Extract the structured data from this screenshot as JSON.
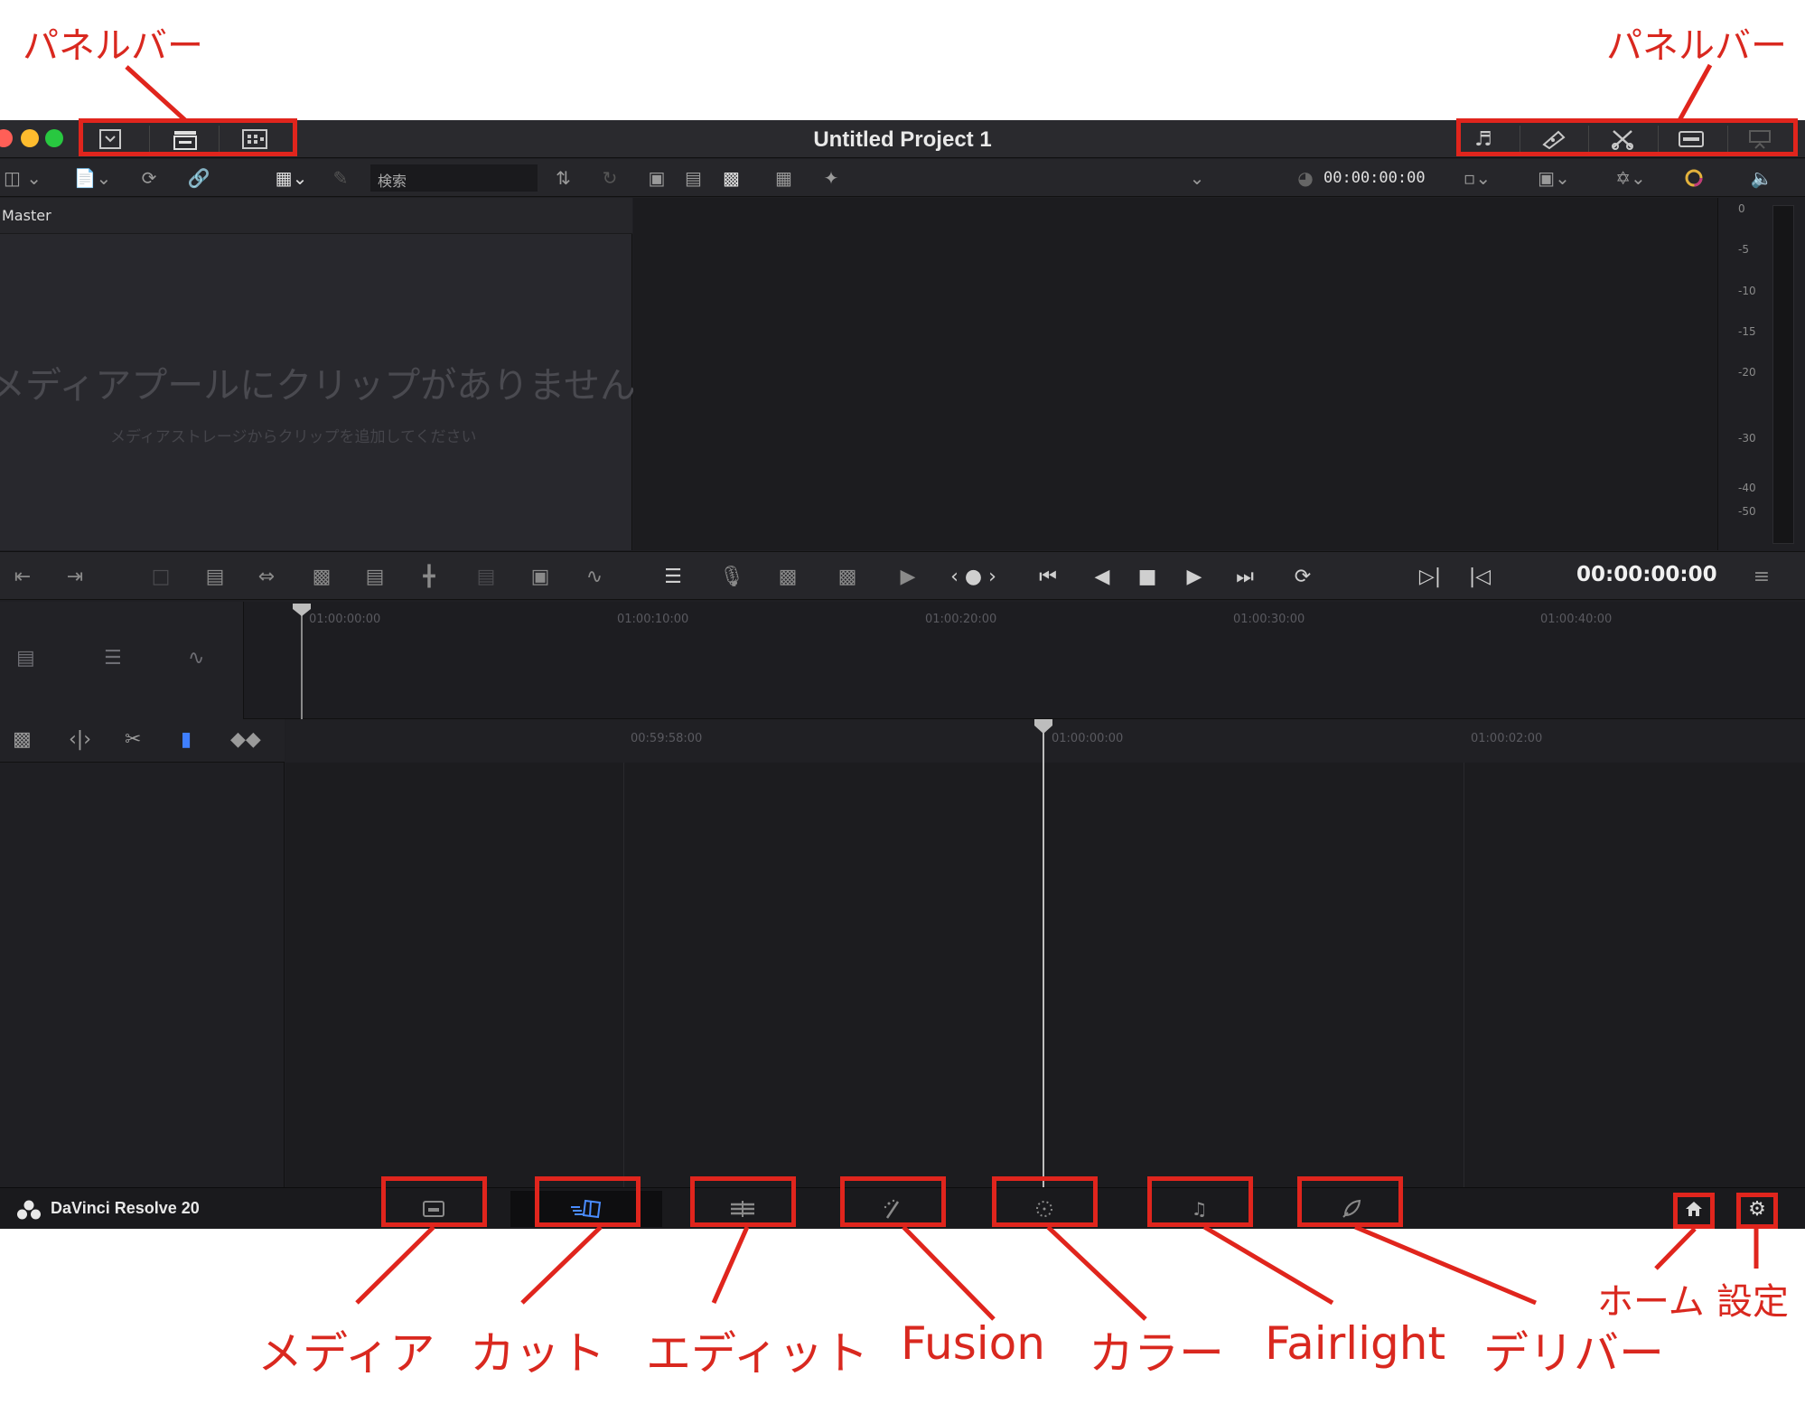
{
  "annotations": {
    "panel_bar_left": "パネルバー",
    "panel_bar_right": "パネルバー",
    "pages": {
      "media": "メディア",
      "cut": "カット",
      "edit": "エディット",
      "fusion": "Fusion",
      "color": "カラー",
      "fairlight": "Fairlight",
      "deliver": "デリバー"
    },
    "home": "ホーム",
    "settings": "設定",
    "annotation_color": "#e0251d"
  },
  "window": {
    "title": "Untitled Project 1"
  },
  "toolbar": {
    "search_placeholder": "検索",
    "source_timecode": "00:00:00:00"
  },
  "media_pool": {
    "bin_name": "Master",
    "empty_title": "メディアプールにクリップがありません",
    "empty_hint": "メディアストレージからクリップを追加してください"
  },
  "audio_meter": {
    "scale": [
      "0",
      "-5",
      "-10",
      "-15",
      "-20",
      "-30",
      "-40",
      "-50"
    ]
  },
  "transport": {
    "timecode": "00:00:00:00"
  },
  "upper_timeline": {
    "ruler": [
      "01:00:00:00",
      "01:00:10:00",
      "01:00:20:00",
      "01:00:30:00",
      "01:00:40:00"
    ]
  },
  "lower_timeline": {
    "ruler": [
      "00:59:58:00",
      "01:00:00:00",
      "01:00:02:00"
    ]
  },
  "footer": {
    "app_name": "DaVinci Resolve 20",
    "active_page": "cut",
    "accent_color": "#4a8cff"
  },
  "colors": {
    "traffic_red": "#ff5f57",
    "traffic_yellow": "#febc2e",
    "traffic_green": "#28c840"
  }
}
